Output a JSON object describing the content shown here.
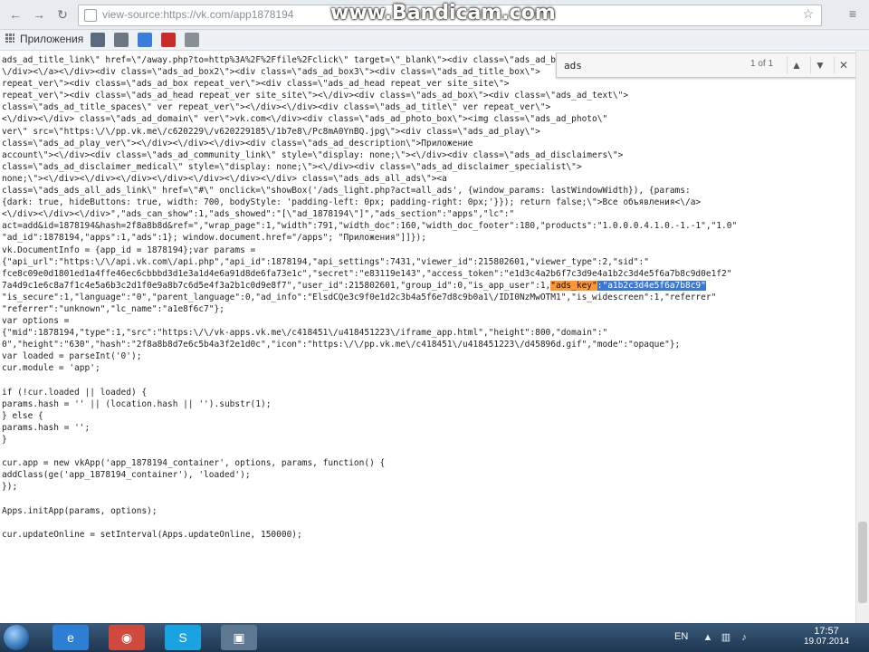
{
  "browser": {
    "url": "view-source:https://vk.com/app1878194",
    "watermark": "www.Bandicam.com",
    "nav": {
      "back": "←",
      "forward": "→",
      "reload": "↻"
    },
    "icons": [
      "back-arrow-icon",
      "forward-arrow-icon",
      "reload-icon",
      "page-icon",
      "bookmark-star-icon",
      "menu-icon"
    ]
  },
  "bookmarks": {
    "apps_label": "Приложения",
    "items": [
      {
        "name": "bookmark-1-icon",
        "color": "#596b7d"
      },
      {
        "name": "bookmark-grid-icon",
        "color": "#6e7781"
      },
      {
        "name": "bookmark-3-icon",
        "color": "#3b7dd8"
      },
      {
        "name": "bookmark-youtube-icon",
        "color": "#cc2b2b"
      },
      {
        "name": "bookmark-5-icon",
        "color": "#8a8f96"
      }
    ]
  },
  "findbar": {
    "query": "ads",
    "count": "1 of 1",
    "prev": "▲",
    "next": "▼",
    "close": "✕"
  },
  "source": {
    "lines": [
      "ads_ad_title_link\\\" href=\\\"/away.php?to=http%3A%2F%2Ffile%2Fclick\\\" target=\\\"_blank\\\"><div class=\\\"ads_ad_box\\\">",
      "\\/div><\\/a><\\/div><div class=\\\"ads_ad_box2\\\"><div class=\\\"ads_ad_box3\\\"><div class=\\\"ads_ad_title_box\\\">",
      "repeat_ver\\\"><div class=\\\"ads_ad_box repeat_ver\\\"><div class=\\\"ads_ad_head repeat_ver site_site\\\">",
      "repeat_ver\\\"><div class=\\\"ads_ad_head repeat_ver site_site\\\"><\\/div><div class=\\\"ads_ad_box\\\"><div class=\\\"ads_ad_text\\\">",
      "class=\\\"ads_ad_title_spaces\\\" ver repeat_ver\\\"><\\/div><\\/div><div class=\\\"ads_ad_title\\\" ver repeat_ver\\\">",
      "<\\/div><\\/div> class=\\\"ads_ad_domain\\\" ver\\\">vk.com<\\/div><div class=\\\"ads_ad_photo_box\\\"><img class=\\\"ads_ad_photo\\\"",
      "ver\\\" src=\\\"https:\\/\\/pp.vk.me\\/c620229\\/v620229185\\/1b7e8\\/Pc8mA0YnBQ.jpg\\\"><div class=\\\"ads_ad_play\\\">",
      "class=\\\"ads_ad_play_ver\\\"><\\/div><\\/div><\\/div><div class=\\\"ads_ad_description\\\">Приложение",
      "account\\\"><\\/div><div class=\\\"ads_ad_community_link\\\" style=\\\"display: none;\\\"><\\/div><div class=\\\"ads_ad_disclaimers\\\">",
      "class=\\\"ads_ad_disclaimer_medical\\\" style=\\\"display: none;\\\"><\\/div><div class=\\\"ads_ad_disclaimer_specialist\\\">",
      "none;\\\"><\\/div><\\/div><\\/div><\\/div><\\/div><\\/div><\\/div> class=\\\"ads_ads_all_ads\\\"><a",
      "class=\\\"ads_ads_all_ads_link\\\" href=\\\"#\\\" onclick=\\\"showBox('/ads_light.php?act=all_ads', {window_params: lastWindowWidth}), {params:",
      "{dark: true, hideButtons: true, width: 700, bodyStyle: 'padding-left: 0px; padding-right: 0px;'}}); return false;\\\">Все объявления<\\/a>",
      "<\\/div><\\/div><\\/div>\",\"ads_can_show\":1,\"ads_showed\":\"[\\\"ad_1878194\\\"]\",\"ads_section\":\"apps\",\"lc\":\"",
      "act=add&id=1878194&hash=2f8a8b8d&ref=\",\"wrap_page\":1,\"width\":791,\"width_doc\":160,\"width_doc_footer\":180,\"products\":\"1.0.0.0.4.1.0.-1.-1\",\"1.0\"",
      "\"ad_id\":1878194,\"apps\":1,\"ads\":1}; window.document.href=\"/apps\"; \"Приложения\"]]});",
      "vk.DocumentInfo = {app_id = 1878194};var params =",
      "{\"api_url\":\"https:\\/\\/api.vk.com\\/api.php\",\"api_id\":1878194,\"api_settings\":7431,\"viewer_id\":215802601,\"viewer_type\":2,\"sid\":\"",
      "fce8c09e0d1801ed1a4ffe46ec6cbbbd3d1e3a1d4e6a91d8de6fa73e1c\",\"secret\":\"e83119e143\",\"access_token\":\"e1d3c4a2b6f7c3d9e4a1b2c3d4e5f6a7b8c9d0e1f2\"",
      "7a4d9c1e6c8a7f1c4e5a6b3c2d1f0e9a8b7c6d5e4f3a2b1c0d9e8f7\",\"user_id\":215802601,\"group_id\":0,\"is_app_user\":1,\"ads_key\":\"a1b2c3d4e5f6a7b8c9\"",
      "\"is_secure\":1,\"language\":\"0\",\"parent_language\":0,\"ad_info\":\"ElsdCQe3c9f0e1d2c3b4a5f6e7d8c9b0a1\\/IDI0NzMwOTM1\",\"is_widescreen\":1,\"referrer\"",
      "\"referrer\":\"unknown\",\"lc_name\":\"a1e8f6c7\"};",
      "var options =",
      "{\"mid\":1878194,\"type\":1,\"src\":\"https:\\/\\/vk-apps.vk.me\\/c418451\\/u418451223\\/iframe_app.html\",\"height\":800,\"domain\":\"",
      "0\",\"height\":\"630\",\"hash\":\"2f8a8b8d7e6c5b4a3f2e1d0c\",\"icon\":\"https:\\/\\/pp.vk.me\\/c418451\\/u418451223\\/d45896d.gif\",\"mode\":\"opaque\"};",
      "var loaded = parseInt('0');",
      "cur.module = 'app';",
      "",
      "if (!cur.loaded || loaded) {",
      "  params.hash = '' || (location.hash || '').substr(1);",
      "} else {",
      "  params.hash = '';",
      "}",
      "",
      "cur.app = new vkApp('app_1878194_container', options, params, function() {",
      "  addClass(ge('app_1878194_container'), 'loaded');",
      "});",
      "",
      "Apps.initApp(params, options);",
      "",
      "cur.updateOnline = setInterval(Apps.updateOnline, 150000);"
    ]
  },
  "taskbar": {
    "apps": [
      {
        "name": "ie-icon",
        "glyph": "e",
        "color": "#2d7fd3"
      },
      {
        "name": "chrome-icon",
        "glyph": "◉",
        "color": "#cf4a3c"
      },
      {
        "name": "skype-icon",
        "glyph": "S",
        "color": "#1aa3e0"
      },
      {
        "name": "bandicam-icon",
        "glyph": "▣",
        "color": "#5e7891"
      }
    ],
    "lang": "EN",
    "time": "17:57",
    "date": "19.07.2014"
  }
}
